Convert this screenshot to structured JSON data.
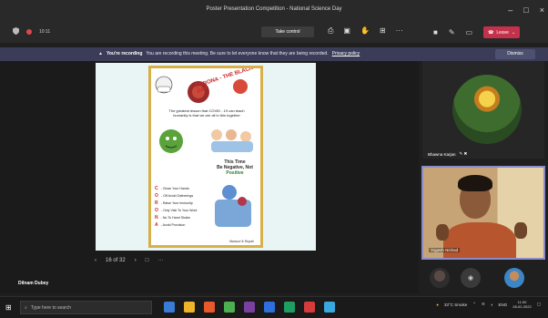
{
  "window": {
    "title": "Poster Presentation Competition - National Science Day",
    "minimize_glyph": "–",
    "maximize_glyph": "□",
    "close_glyph": "×"
  },
  "toolbar": {
    "recording_glyph": "●",
    "timer": "10:11",
    "take_control_label": "Take control",
    "leave_label": "Leave",
    "icons": [
      "share-icon",
      "chat-icon",
      "reactions-icon",
      "more-icon",
      "camera-icon",
      "mic-icon",
      "screen-share-icon"
    ]
  },
  "banner": {
    "heading": "You're recording",
    "message": "You are recording this meeting. Be sure to let everyone know that they are being recorded.",
    "link": "Privacy policy",
    "dismiss_label": "Dismiss"
  },
  "slide": {
    "poster": {
      "title": "CORONA - THE BLACK DAY",
      "line1": "The greatest lesson that COVID - 19 can teach",
      "line2": "humanity is that we are all in this together",
      "negative_line1": "This Time",
      "negative_prefix": "Be Negative, Not ",
      "negative_accent": "Positive",
      "acrostic": [
        {
          "letter": "C",
          "text": "- Clean Your Hands"
        },
        {
          "letter": "O",
          "text": "- Off Avoid Gatherings"
        },
        {
          "letter": "R",
          "text": "- Raise Your Immunity"
        },
        {
          "letter": "O",
          "text": "- Only Visit To Your Work"
        },
        {
          "letter": "N",
          "text": "- No To Hand Shake"
        },
        {
          "letter": "A",
          "text": "- Avoid Provision"
        }
      ],
      "signature": "Mansuri & Rupali"
    },
    "pager": {
      "prev": "‹",
      "page_text": "16 of 32",
      "next": "›",
      "extra1": "□",
      "extra2": "···"
    }
  },
  "presenter": {
    "name": "Dilnam Dubey"
  },
  "participants": [
    {
      "name": "Bhawna Karjan",
      "icons": "✎ ✖"
    },
    {
      "name": "Yogesh Nishad"
    }
  ],
  "taskbar": {
    "search_placeholder": "Type here to search",
    "weather": "33°C Smoke",
    "lang": "ENG",
    "time": "11:00",
    "date": "28-02-2022",
    "app_colors": [
      "#3a7bd5",
      "#f0b429",
      "#e85a2b",
      "#4caf50",
      "#7b3fa0",
      "#2f6fdd",
      "#1e9e62",
      "#d63b3b",
      "#3aa8e0"
    ]
  }
}
